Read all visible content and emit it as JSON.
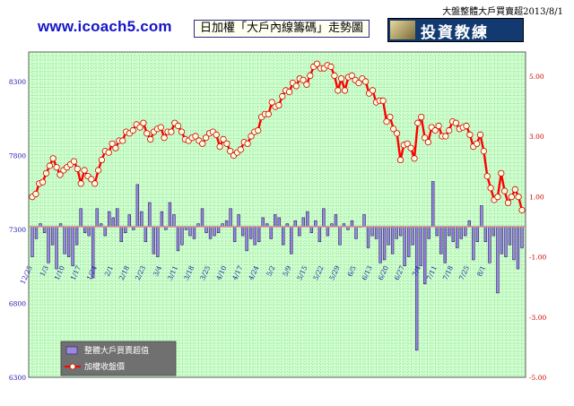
{
  "page": {
    "top_title": "大盤整體大戶買賣超2013/8/1",
    "site_url": "www.icoach5.com",
    "chart_title": "日加權「大戶內線籌碼」走勢圖",
    "logo_text": "投資教練"
  },
  "colors": {
    "plot_bg": "#ccffcc",
    "grid": "#6aa56a",
    "bar": "#9b88e0",
    "bar_edge": "#2a1f66",
    "line": "#ff0000",
    "marker_fill": "#ffffdd",
    "marker_edge": "#cc0000",
    "zero_line": "#d09090",
    "right_ticks": "#cc0000",
    "left_ticks": "#1a1aaa"
  },
  "chart_data": {
    "type": "bar+line",
    "x_ticks": [
      "12/25",
      "1/3",
      "1/10",
      "1/17",
      "1/24",
      "2/1",
      "2/18",
      "2/23",
      "3/4",
      "3/11",
      "3/18",
      "3/25",
      "4/10",
      "4/17",
      "4/24",
      "5/2",
      "5/9",
      "5/15",
      "5/22",
      "5/29",
      "6/5",
      "6/13",
      "6/20",
      "6/27",
      "7/4",
      "7/11",
      "7/18",
      "7/25",
      "8/1"
    ],
    "x_tick_index": [
      0,
      4,
      8,
      12,
      16,
      20,
      24,
      28,
      32,
      36,
      40,
      44,
      48,
      52,
      56,
      60,
      64,
      68,
      72,
      76,
      80,
      84,
      88,
      92,
      96,
      100,
      104,
      108,
      112
    ],
    "left_axis": {
      "range": [
        6300,
        8500
      ],
      "ticks": [
        6300,
        6800,
        7300,
        7800,
        8300
      ]
    },
    "right_axis": {
      "range": [
        -5,
        5.8
      ],
      "ticks": [
        "-5.00",
        "-3.00",
        "-1.00",
        "1.00",
        "3.00",
        "5.00"
      ]
    },
    "series": [
      {
        "name": "整體大戶買賣超值",
        "type": "bar",
        "axis": "right",
        "values": [
          -1.0,
          -0.4,
          0.1,
          -0.2,
          -1.2,
          -0.6,
          -1.4,
          0.1,
          -0.9,
          -1.0,
          -1.3,
          -0.6,
          0.6,
          -0.2,
          -0.3,
          -1.7,
          0.6,
          0.1,
          -0.3,
          0.5,
          0.3,
          0.6,
          -0.5,
          -0.2,
          0.4,
          -0.1,
          1.4,
          0.5,
          -0.5,
          0.8,
          -0.9,
          -1.0,
          0.5,
          -0.1,
          0.8,
          0.4,
          -0.8,
          -0.6,
          -0.1,
          -0.3,
          -0.4,
          0.1,
          0.6,
          -0.2,
          -0.4,
          -0.3,
          -0.2,
          0.1,
          0.2,
          0.6,
          -0.5,
          0.4,
          -0.3,
          -0.8,
          -0.4,
          -0.6,
          -0.5,
          0.3,
          0.1,
          -0.4,
          0.4,
          0.3,
          -0.6,
          0.1,
          -0.9,
          0.2,
          -0.3,
          0.3,
          0.5,
          -0.2,
          0.2,
          -0.5,
          0.6,
          -0.3,
          0.1,
          0.4,
          -0.6,
          0.1,
          -0.1,
          0.2,
          -0.4,
          0.0,
          0.4,
          -0.7,
          -0.3,
          -0.4,
          -1.2,
          -1.1,
          -0.6,
          -0.9,
          -0.4,
          -0.3,
          -1.3,
          -1.0,
          -0.6,
          -4.1,
          -1.3,
          -1.9,
          -0.4,
          1.5,
          -0.3,
          -0.9,
          -1.2,
          -0.3,
          -0.5,
          -0.7,
          -0.4,
          -0.3,
          0.2,
          -1.1,
          -0.5,
          0.7,
          -0.5,
          -1.2,
          -0.3,
          -2.2,
          -0.9,
          -1.0,
          -0.6,
          -1.1,
          -1.4,
          -0.7
        ]
      },
      {
        "name": "加權收盤價",
        "type": "line",
        "axis": "left",
        "values": [
          7520,
          7540,
          7610,
          7620,
          7680,
          7730,
          7780,
          7720,
          7670,
          7700,
          7720,
          7740,
          7760,
          7710,
          7610,
          7700,
          7660,
          7640,
          7610,
          7700,
          7770,
          7830,
          7820,
          7880,
          7850,
          7900,
          7900,
          7960,
          7950,
          7970,
          8010,
          7990,
          8020,
          7950,
          7910,
          7960,
          7980,
          7990,
          7920,
          7960,
          7960,
          8020,
          8000,
          7960,
          7910,
          7900,
          7920,
          7930,
          7900,
          7880,
          7920,
          7950,
          7960,
          7940,
          7860,
          7910,
          7880,
          7830,
          7800,
          7820,
          7840,
          7890,
          7880,
          7930,
          7960,
          7970,
          8060,
          8080,
          8080,
          8160,
          8130,
          8140,
          8200,
          8240,
          8230,
          8290,
          8270,
          8320,
          8310,
          8280,
          8340,
          8400,
          8420,
          8390,
          8390,
          8410,
          8400,
          8340,
          8240,
          8320,
          8240,
          8330,
          8340,
          8310,
          8290,
          8320,
          8300,
          8220,
          8240,
          8160,
          8170,
          8170,
          8030,
          8060,
          7980,
          7950,
          7770,
          7870,
          7880,
          7850,
          7780,
          8020,
          8060,
          7920,
          7890,
          7990,
          7970,
          8000,
          7930,
          7930,
          7970,
          8030,
          8020,
          7980,
          7990,
          8000,
          7940,
          7860,
          7880,
          7940,
          7830,
          7660,
          7580,
          7500,
          7520,
          7680,
          7560,
          7480,
          7520,
          7570,
          7520,
          7430
        ]
      }
    ]
  }
}
